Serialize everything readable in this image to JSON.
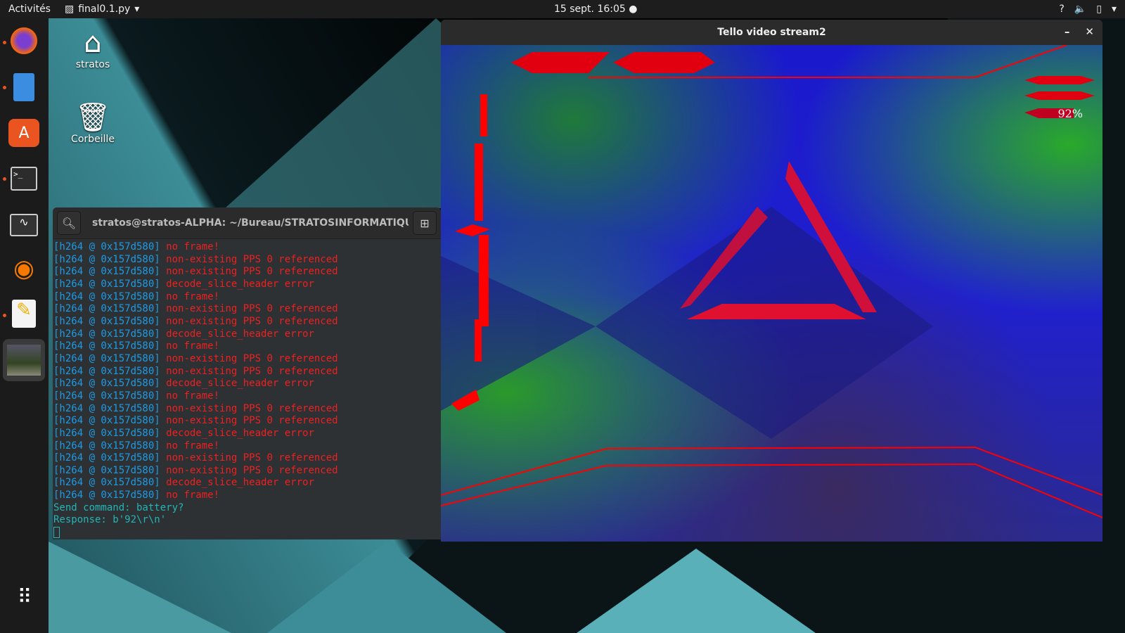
{
  "topbar": {
    "activities": "Activités",
    "app_name": "final0.1.py",
    "clock": "15 sept.  16:05"
  },
  "desktop": {
    "icons": [
      {
        "label": "stratos"
      },
      {
        "label": "Corbeille"
      }
    ]
  },
  "terminal": {
    "title": "stratos@stratos-ALPHA: ~/Bureau/STRATOSINFORMATIQU...",
    "prefix": "[h264 @ 0x157d580]",
    "lines": [
      "no frame!",
      "non-existing PPS 0 referenced",
      "non-existing PPS 0 referenced",
      "decode_slice_header error",
      "no frame!",
      "non-existing PPS 0 referenced",
      "non-existing PPS 0 referenced",
      "decode_slice_header error",
      "no frame!",
      "non-existing PPS 0 referenced",
      "non-existing PPS 0 referenced",
      "decode_slice_header error",
      "no frame!",
      "non-existing PPS 0 referenced",
      "non-existing PPS 0 referenced",
      "decode_slice_header error",
      "no frame!",
      "non-existing PPS 0 referenced",
      "non-existing PPS 0 referenced",
      "decode_slice_header error",
      "no frame!"
    ],
    "send": "Send command: battery?",
    "response": "Response: b'92\\r\\n'"
  },
  "video": {
    "title": "Tello video stream2",
    "battery": "92%"
  }
}
